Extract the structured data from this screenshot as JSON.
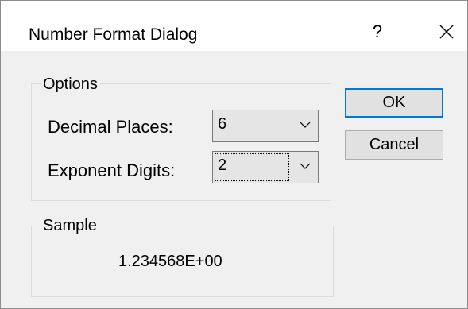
{
  "window": {
    "title": "Number Format Dialog",
    "help_glyph": "?",
    "close_icon": "close-icon"
  },
  "options": {
    "group_label": "Options",
    "decimal_places": {
      "label": "Decimal Places:",
      "value": "6"
    },
    "exponent_digits": {
      "label": "Exponent Digits:",
      "value": "2"
    }
  },
  "sample": {
    "group_label": "Sample",
    "value": "1.234568E+00"
  },
  "buttons": {
    "ok_label": "OK",
    "cancel_label": "Cancel"
  },
  "colors": {
    "default_button_border": "#0078d7",
    "dialog_background": "#f0f0f0",
    "titlebar_background": "#ffffff"
  }
}
